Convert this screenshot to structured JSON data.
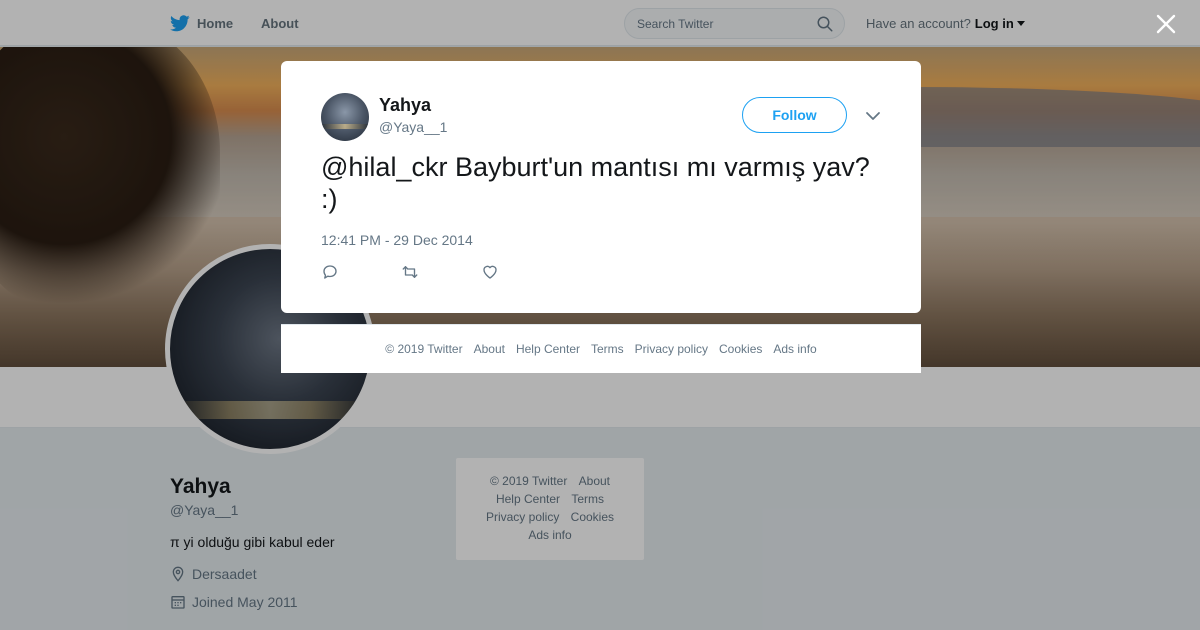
{
  "colors": {
    "brand_blue": "#1da1f2",
    "muted_text": "#657786",
    "text": "#14171a"
  },
  "topbar": {
    "home_label": "Home",
    "about_label": "About",
    "search_placeholder": "Search Twitter",
    "have_account_text": "Have an account?",
    "login_label": "Log in"
  },
  "profile": {
    "name": "Yahya",
    "handle": "@Yaya__1",
    "bio": "π yi olduğu gibi kabul eder",
    "location": "Dersaadet",
    "joined": "Joined May 2011"
  },
  "side_footer": {
    "copyright": "© 2019 Twitter",
    "links": [
      "About",
      "Help Center",
      "Terms",
      "Privacy policy",
      "Cookies",
      "Ads info"
    ]
  },
  "tweet": {
    "author_name": "Yahya",
    "author_handle": "@Yaya__1",
    "follow_label": "Follow",
    "text": "@hilal_ckr Bayburt'un mantısı mı varmış yav? :)",
    "timestamp": "12:41 PM - 29 Dec 2014"
  },
  "modal_footer": {
    "copyright": "© 2019 Twitter",
    "links": [
      "About",
      "Help Center",
      "Terms",
      "Privacy policy",
      "Cookies",
      "Ads info"
    ]
  },
  "icons": {
    "logo": "twitter-bird-icon",
    "search": "search-icon",
    "close": "close-icon",
    "more": "chevron-down-icon",
    "reply": "reply-icon",
    "retweet": "retweet-icon",
    "like": "heart-icon",
    "location": "location-pin-icon",
    "calendar": "calendar-icon"
  }
}
